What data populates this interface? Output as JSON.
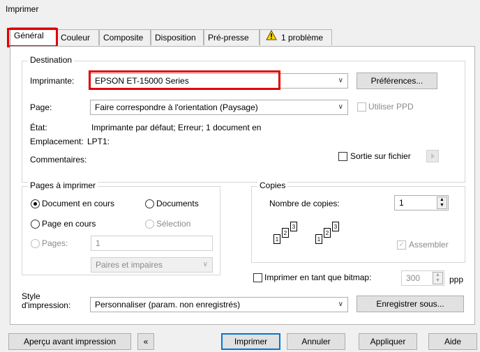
{
  "window": {
    "title": "Imprimer"
  },
  "tabs": [
    {
      "label": "Général"
    },
    {
      "label": "Couleur"
    },
    {
      "label": "Composite"
    },
    {
      "label": "Disposition"
    },
    {
      "label": "Pré-presse"
    },
    {
      "label": "1 problème",
      "icon": "warning-icon"
    }
  ],
  "destination": {
    "group_label": "Destination",
    "printer_label": "Imprimante:",
    "printer_value": "EPSON ET-15000 Series",
    "preferences_button": "Préférences...",
    "page_label": "Page:",
    "page_value": "Faire correspondre à l'orientation (Paysage)",
    "use_ppd_label": "Utiliser PPD",
    "state_label": "État:",
    "state_value": "Imprimante par défaut; Erreur; 1 document en",
    "location_label": "Emplacement:",
    "location_value": "LPT1:",
    "comments_label": "Commentaires:",
    "print_to_file_label": "Sortie sur fichier"
  },
  "pages": {
    "group_label": "Pages à imprimer",
    "current_document": "Document en cours",
    "documents": "Documents",
    "current_page": "Page en cours",
    "selection": "Sélection",
    "pages_label": "Pages:",
    "pages_value": "1",
    "parity_value": "Paires et impaires"
  },
  "copies": {
    "group_label": "Copies",
    "count_label": "Nombre de copies:",
    "count_value": "1",
    "collate_label": "Assembler",
    "sheet_numbers": [
      "1",
      "2",
      "3"
    ]
  },
  "bitmap": {
    "label": "Imprimer en tant que bitmap:",
    "dpi_value": "300",
    "unit": "ppp"
  },
  "style": {
    "label_line1": "Style",
    "label_line2": "d'impression:",
    "value": "Personnaliser (param. non enregistrés)",
    "save_as_button": "Enregistrer sous..."
  },
  "footer": {
    "preview_button": "Aperçu avant impression",
    "collapse_icon": "double-chevron-left-icon",
    "print_button": "Imprimer",
    "cancel_button": "Annuler",
    "apply_button": "Appliquer",
    "help_button": "Aide"
  },
  "colors": {
    "highlight": "#e00000",
    "default_button_border": "#0078d7"
  }
}
